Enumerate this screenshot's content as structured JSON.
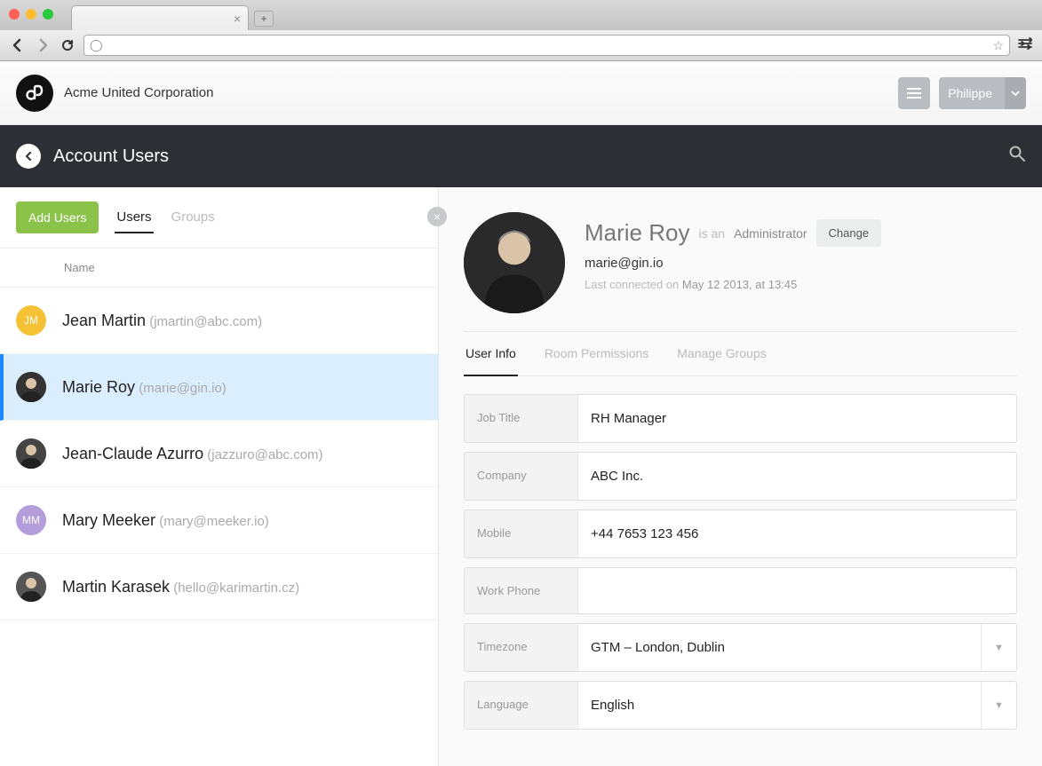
{
  "browser": {
    "url": ""
  },
  "header": {
    "company": "Acme United Corporation",
    "user": "Philippe"
  },
  "section": {
    "title": "Account Users"
  },
  "left": {
    "add_btn": "Add Users",
    "tabs": {
      "users": "Users",
      "groups": "Groups"
    },
    "name_header": "Name",
    "users": [
      {
        "initials": "JM",
        "name": "Jean Martin",
        "email": "(jmartin@abc.com)",
        "avatar_color": "#f5c236",
        "selected": false
      },
      {
        "initials": "",
        "name": "Marie Roy",
        "email": "(marie@gin.io)",
        "avatar_color": "#333",
        "selected": true
      },
      {
        "initials": "",
        "name": "Jean-Claude Azurro",
        "email": "(jazzuro@abc.com)",
        "avatar_color": "#444",
        "selected": false
      },
      {
        "initials": "MM",
        "name": "Mary Meeker",
        "email": "(mary@meeker.io)",
        "avatar_color": "#b39ddb",
        "selected": false
      },
      {
        "initials": "",
        "name": "Martin Karasek",
        "email": "(hello@karimartin.cz)",
        "avatar_color": "#555",
        "selected": false
      }
    ]
  },
  "profile": {
    "name": "Marie Roy",
    "isan": "is an",
    "role": "Administrator",
    "change": "Change",
    "email": "marie@gin.io",
    "last_label": "Last connected on",
    "last_date": "May 12 2013, at 13:45"
  },
  "detail_tabs": {
    "info": "User Info",
    "perms": "Room Permissions",
    "groups": "Manage Groups"
  },
  "fields": {
    "job_title": {
      "label": "Job Title",
      "value": "RH Manager"
    },
    "company": {
      "label": "Company",
      "value": "ABC Inc."
    },
    "mobile": {
      "label": "Mobile",
      "value": "+44 7653 123 456"
    },
    "work_phone": {
      "label": "Work Phone",
      "value": ""
    },
    "timezone": {
      "label": "Timezone",
      "value": "GTM – London, Dublin"
    },
    "language": {
      "label": "Language",
      "value": "English"
    }
  }
}
